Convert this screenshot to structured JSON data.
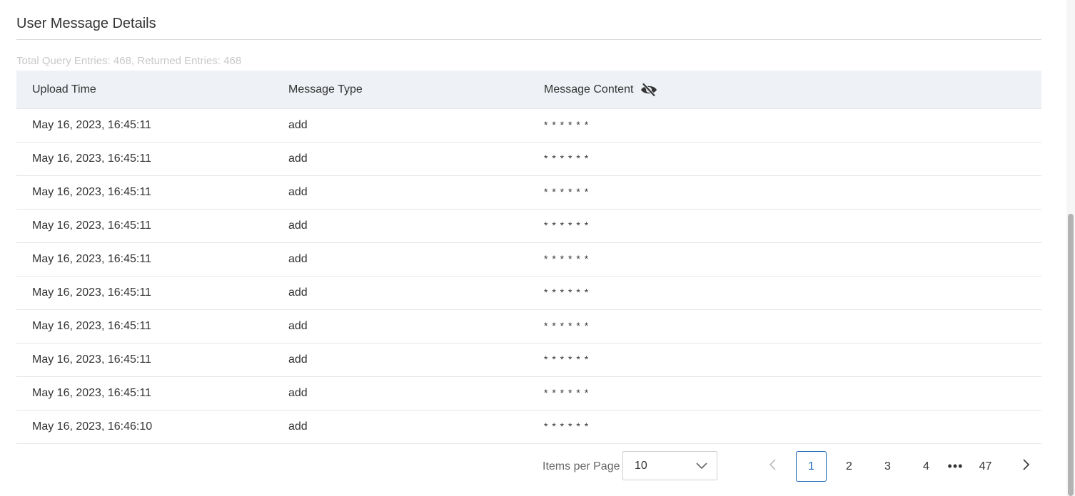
{
  "section": {
    "title": "User Message Details",
    "summary": "Total Query Entries: 468, Returned Entries: 468"
  },
  "table": {
    "headers": {
      "upload_time": "Upload Time",
      "message_type": "Message Type",
      "message_content": "Message Content"
    },
    "rows": [
      {
        "upload_time": "May 16, 2023, 16:45:11",
        "message_type": "add",
        "message_content": "* * * * * *"
      },
      {
        "upload_time": "May 16, 2023, 16:45:11",
        "message_type": "add",
        "message_content": "* * * * * *"
      },
      {
        "upload_time": "May 16, 2023, 16:45:11",
        "message_type": "add",
        "message_content": "* * * * * *"
      },
      {
        "upload_time": "May 16, 2023, 16:45:11",
        "message_type": "add",
        "message_content": "* * * * * *"
      },
      {
        "upload_time": "May 16, 2023, 16:45:11",
        "message_type": "add",
        "message_content": "* * * * * *"
      },
      {
        "upload_time": "May 16, 2023, 16:45:11",
        "message_type": "add",
        "message_content": "* * * * * *"
      },
      {
        "upload_time": "May 16, 2023, 16:45:11",
        "message_type": "add",
        "message_content": "* * * * * *"
      },
      {
        "upload_time": "May 16, 2023, 16:45:11",
        "message_type": "add",
        "message_content": "* * * * * *"
      },
      {
        "upload_time": "May 16, 2023, 16:45:11",
        "message_type": "add",
        "message_content": "* * * * * *"
      },
      {
        "upload_time": "May 16, 2023, 16:46:10",
        "message_type": "add",
        "message_content": "* * * * * *"
      }
    ],
    "content_visibility_icon": "eye-slash-icon"
  },
  "pagination": {
    "items_per_page_label": "Items per Page",
    "items_per_page_value": "10",
    "pages": [
      "1",
      "2",
      "3",
      "4"
    ],
    "ellipsis": "•••",
    "last_page": "47",
    "current_page": "1",
    "active_color": "#1e6ab8"
  }
}
